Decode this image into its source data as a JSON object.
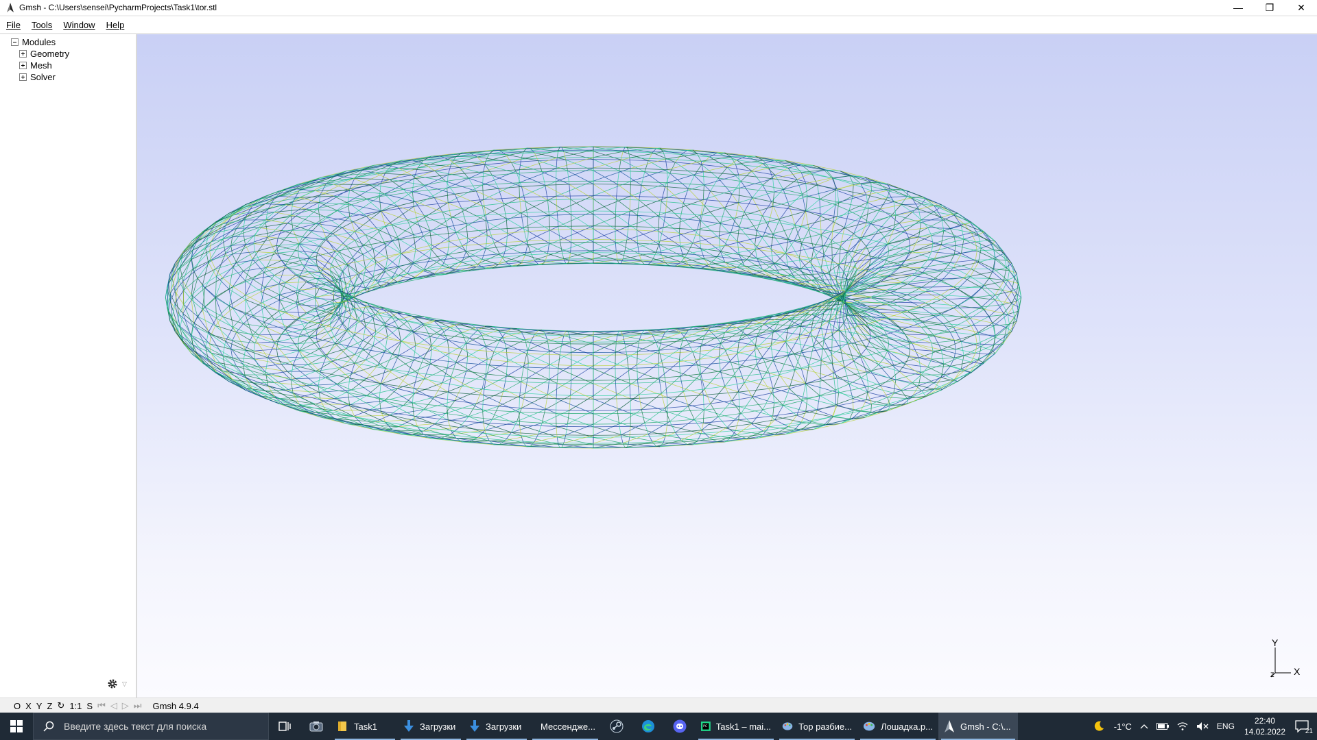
{
  "window": {
    "title": "Gmsh - C:\\Users\\sensei\\PycharmProjects\\Task1\\tor.stl",
    "controls": {
      "minimize": "—",
      "restore": "❐",
      "close": "✕"
    }
  },
  "menu": [
    "File",
    "Tools",
    "Window",
    "Help"
  ],
  "tree": {
    "root": "Modules",
    "children": [
      "Geometry",
      "Mesh",
      "Solver"
    ]
  },
  "axes": {
    "x": "X",
    "y": "Y",
    "z": "Z"
  },
  "statusbar": {
    "buttons": [
      "O",
      "X",
      "Y",
      "Z",
      "↻",
      "1:1",
      "S"
    ],
    "nav": [
      "⏮",
      "◁",
      "▷",
      "⏭"
    ],
    "version": "Gmsh 4.9.4"
  },
  "taskbar": {
    "search_placeholder": "Введите здесь текст для поиска",
    "apps": [
      {
        "label": "Task1",
        "icon": "folder-icon",
        "color": "#f3c74a"
      },
      {
        "label": "Загрузки",
        "icon": "download-icon",
        "color": "#3b8fe0"
      },
      {
        "label": "Загрузки",
        "icon": "download-icon",
        "color": "#3b8fe0"
      },
      {
        "label": "Мессендже...",
        "icon": "chrome-icon",
        "color": "#e04a3b"
      },
      {
        "label": "Task1 – mai...",
        "icon": "pycharm-icon",
        "color": "#21d789"
      },
      {
        "label": "Тор разбие...",
        "icon": "paint-icon",
        "color": "#8ab4e6"
      },
      {
        "label": "Лошадка.p...",
        "icon": "paint-icon",
        "color": "#8ab4e6"
      },
      {
        "label": "Gmsh - C:\\...",
        "icon": "gmsh-icon",
        "color": "#ffffff"
      }
    ],
    "tray": {
      "temperature": "-1°C",
      "language": "ENG",
      "time": "22:40",
      "date": "14.02.2022",
      "notifications": "21"
    }
  }
}
